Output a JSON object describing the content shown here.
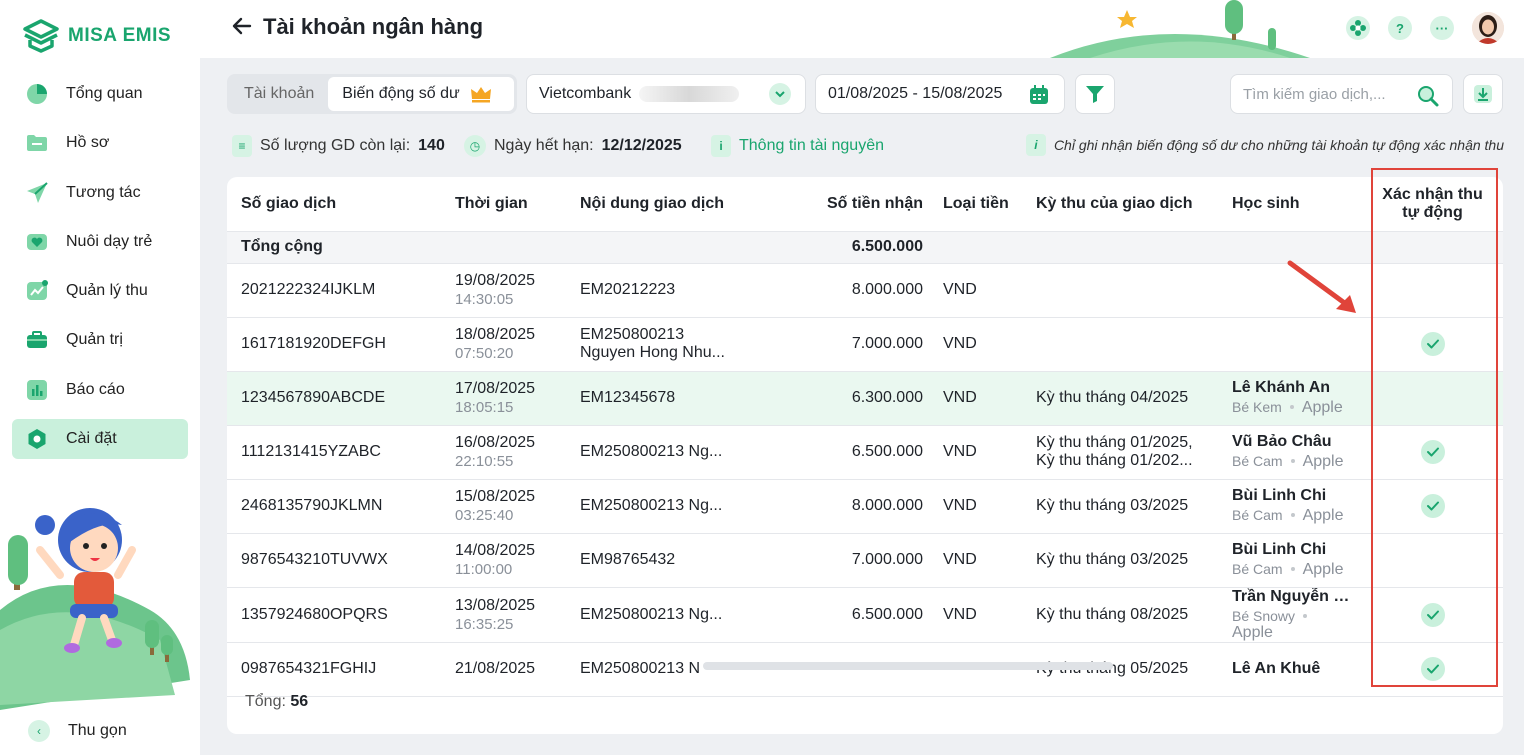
{
  "app": {
    "logo_text": "MISA EMIS"
  },
  "sidebar": {
    "items": [
      {
        "label": "Tổng quan",
        "icon": "pie-chart-icon"
      },
      {
        "label": "Hồ sơ",
        "icon": "folder-icon"
      },
      {
        "label": "Tương tác",
        "icon": "paper-plane-icon"
      },
      {
        "label": "Nuôi dạy trẻ",
        "icon": "heart-icon"
      },
      {
        "label": "Quản lý thu",
        "icon": "trend-chart-icon"
      },
      {
        "label": "Quản trị",
        "icon": "briefcase-icon"
      },
      {
        "label": "Báo cáo",
        "icon": "bar-chart-icon"
      },
      {
        "label": "Cài đặt",
        "icon": "settings-icon",
        "active": true
      }
    ],
    "collapse_label": "Thu gọn"
  },
  "header": {
    "title": "Tài khoản ngân hàng",
    "icons": [
      "flower-icon",
      "help-icon",
      "more-icon",
      "user-avatar"
    ]
  },
  "toolbar": {
    "tabs": [
      {
        "label": "Tài khoản",
        "active": false
      },
      {
        "label": "Biến động số dư",
        "active": true,
        "badge_icon": "crown-icon"
      }
    ],
    "bank_select": "Vietcombank",
    "date_range": "01/08/2025 - 15/08/2025",
    "search_placeholder": "Tìm kiếm giao dịch,..."
  },
  "info": {
    "remaining_label": "Số lượng GD còn lại:",
    "remaining_value": "140",
    "expiry_label": "Ngày hết hạn:",
    "expiry_value": "12/12/2025",
    "resource_link": "Thông tin tài nguyên",
    "note": "Chỉ ghi nhận biến động số dư cho những tài khoản tự động xác nhận thu"
  },
  "table": {
    "headers": {
      "txn_id": "Số giao dịch",
      "time": "Thời gian",
      "content": "Nội dung giao dịch",
      "amount": "Số tiền nhận",
      "currency": "Loại tiền",
      "period": "Kỳ thu của giao dịch",
      "student": "Học sinh",
      "auto_confirm_line1": "Xác nhận thu",
      "auto_confirm_line2": "tự động"
    },
    "total_label": "Tổng cộng",
    "total_amount": "6.500.000",
    "rows": [
      {
        "txn_id": "2021222324IJKLM",
        "date": "19/08/2025",
        "time": "14:30:05",
        "content": "EM20212223",
        "content2": "",
        "amount": "8.000.000",
        "currency": "VND",
        "period": "",
        "period2": "",
        "student": "",
        "class": "",
        "org": "",
        "confirmed": false,
        "highlight": false
      },
      {
        "txn_id": "1617181920DEFGH",
        "date": "18/08/2025",
        "time": "07:50:20",
        "content": "EM250800213",
        "content2": "Nguyen Hong Nhu...",
        "amount": "7.000.000",
        "currency": "VND",
        "period": "",
        "period2": "",
        "student": "",
        "class": "",
        "org": "",
        "confirmed": true,
        "highlight": false
      },
      {
        "txn_id": "1234567890ABCDE",
        "date": "17/08/2025",
        "time": "18:05:15",
        "content": "EM12345678",
        "content2": "",
        "amount": "6.300.000",
        "currency": "VND",
        "period": "Kỳ thu tháng 04/2025",
        "period2": "",
        "student": "Lê Khánh An",
        "class": "Bé Kem",
        "org": "Apple",
        "confirmed": false,
        "highlight": true
      },
      {
        "txn_id": "1112131415YZABC",
        "date": "16/08/2025",
        "time": "22:10:55",
        "content": "EM250800213 Ng...",
        "content2": "",
        "amount": "6.500.000",
        "currency": "VND",
        "period": "Kỳ thu tháng 01/2025,",
        "period2": "Kỳ thu tháng 01/202...",
        "student": "Vũ Bảo Châu",
        "class": "Bé Cam",
        "org": "Apple",
        "confirmed": true,
        "highlight": false
      },
      {
        "txn_id": "2468135790JKLMN",
        "date": "15/08/2025",
        "time": "03:25:40",
        "content": "EM250800213 Ng...",
        "content2": "",
        "amount": "8.000.000",
        "currency": "VND",
        "period": "Kỳ thu tháng 03/2025",
        "period2": "",
        "student": "Bùi Linh Chi",
        "class": "Bé Cam",
        "org": "Apple",
        "confirmed": true,
        "highlight": false
      },
      {
        "txn_id": "9876543210TUVWX",
        "date": "14/08/2025",
        "time": "11:00:00",
        "content": "EM98765432",
        "content2": "",
        "amount": "7.000.000",
        "currency": "VND",
        "period": "Kỳ thu tháng 03/2025",
        "period2": "",
        "student": "Bùi Linh Chi",
        "class": "Bé Cam",
        "org": "Apple",
        "confirmed": false,
        "highlight": false
      },
      {
        "txn_id": "1357924680OPQRS",
        "date": "13/08/2025",
        "time": "16:35:25",
        "content": "EM250800213 Ng...",
        "content2": "",
        "amount": "6.500.000",
        "currency": "VND",
        "period": "Kỳ thu tháng 08/2025",
        "period2": "",
        "student": "Trần Nguyễn M...",
        "class": "Bé Snowy",
        "org": "Apple",
        "confirmed": true,
        "highlight": false
      },
      {
        "txn_id": "0987654321FGHIJ",
        "date": "21/08/2025",
        "time": "",
        "content": "EM250800213 N",
        "content2": "",
        "amount": "",
        "currency": "",
        "period": "Kỳ thu tháng 05/2025",
        "period2": "",
        "student": "Lê An Khuê",
        "class": "",
        "org": "",
        "confirmed": true,
        "highlight": false
      }
    ]
  },
  "footer": {
    "total_label": "Tổng:",
    "total_value": "56"
  },
  "colors": {
    "brand": "#1aa56e",
    "highlight_row": "#eaf8f0",
    "annotation": "#e0443a"
  }
}
